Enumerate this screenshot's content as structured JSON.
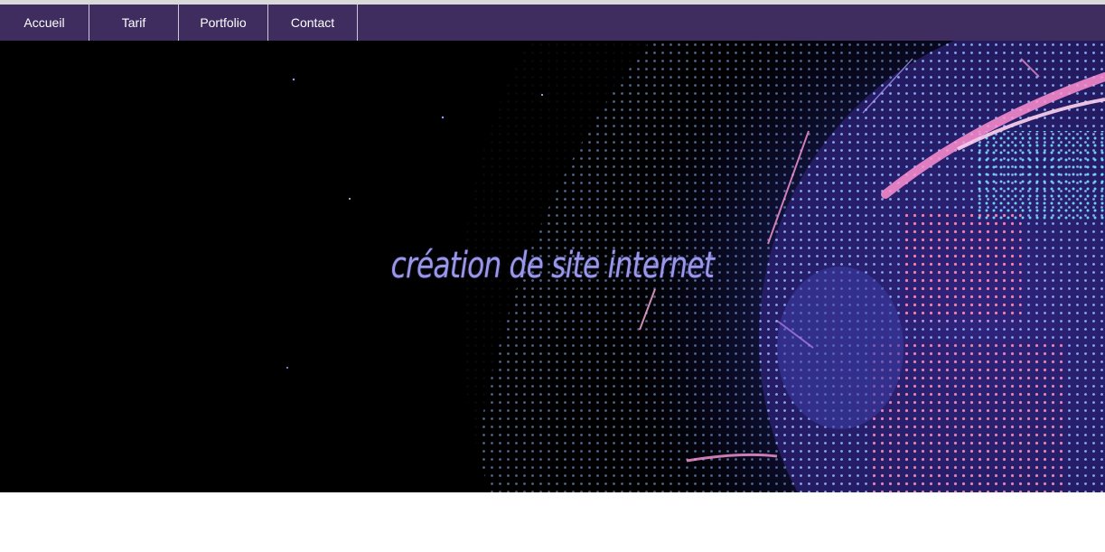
{
  "nav": {
    "items": [
      {
        "label": "Accueil"
      },
      {
        "label": "Tarif"
      },
      {
        "label": "Portfolio"
      },
      {
        "label": "Contact"
      }
    ]
  },
  "hero": {
    "title": "création de site internet",
    "image": "globe-network-image"
  },
  "colors": {
    "nav_background": "#3f2d5f",
    "hero_title": "#9a97e8",
    "hero_background": "#000000"
  }
}
